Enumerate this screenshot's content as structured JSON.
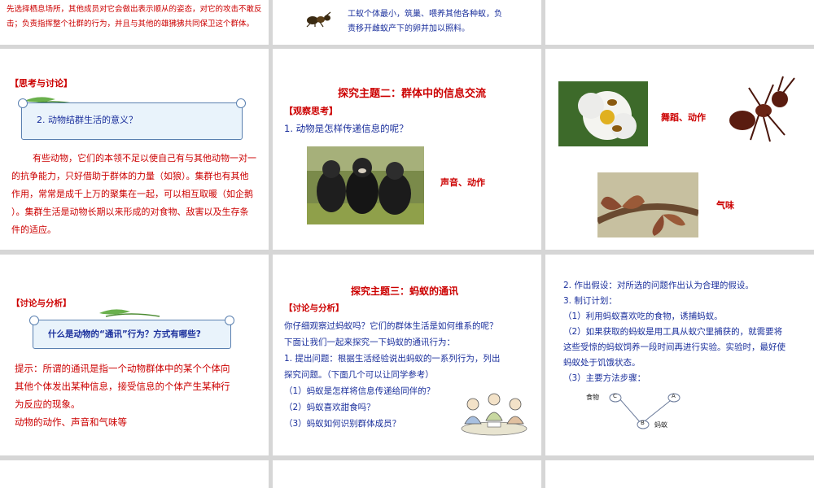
{
  "s1": {
    "line1": "先选择栖息场所，其他成员对它会做出表示顺从的姿态，对它的攻击不敢反",
    "line2": "击；负责指挥整个社群的行为，并且与其他的雄狒狒共同保卫这个群体。"
  },
  "s2": {
    "line1": "工蚁个体最小，筑巢、喂养其他各种蚁，负",
    "line2": "责移开雌蚁产下的卵并加以照料。"
  },
  "s4": {
    "heading": "【思考与讨论】",
    "question": "2. 动物结群生活的意义？",
    "p": [
      "有些动物，它们的本领不足以使自己有与其他动物一对一",
      "的抗争能力，只好借助于群体的力量（如狼）。集群也有其他",
      "作用，常常是成千上万的聚集在一起，可以相互取暖（如企鹅",
      "）。集群生活是动物长期以来形成的对食物、敌害以及生存条",
      "件的适应。"
    ]
  },
  "s5": {
    "title": "探究主题二：群体中的信息交流",
    "heading": "【观察思考】",
    "question": "1. 动物是怎样传递信息的呢？",
    "caption": "声音、动作"
  },
  "s6": {
    "caption1": "舞蹈、动作",
    "caption2": "气味"
  },
  "s7": {
    "heading": "【讨论与分析】",
    "question": "什么是动物的“通讯”行为？方式有哪些?",
    "p": [
      "提示：所谓的通讯是指一个动物群体中的某个个体向",
      "其他个体发出某种信息，接受信息的个体产生某种行",
      "为反应的现象。"
    ],
    "answer": "动物的动作、声音和气味等"
  },
  "s8": {
    "title": "探究主题三：蚂蚁的通讯",
    "heading": "【讨论与分析】",
    "lines": [
      "你仔细观察过蚂蚁吗？它们的群体生活是如何维系的呢？",
      "下面让我们一起来探究一下蚂蚁的通讯行为：",
      "1. 提出问题：根据生活经验说出蚂蚁的一系列行为，列出",
      "探究问题。（下面几个可以让同学参考）",
      "（1）蚂蚁是怎样将信息传递给同伴的？",
      "（2）蚂蚁喜欢甜食吗？",
      "（3）蚂蚁如何识别群体成员？"
    ]
  },
  "s9": {
    "lines": [
      "2. 作出假设：对所选的问题作出认为合理的假设。",
      "3. 制订计划：",
      "（1）利用蚂蚁喜欢吃的食物，诱捕蚂蚁。",
      "（2）如果获取的蚂蚁是用工具从蚁穴里捕获的，就需要将",
      "这些受惊的蚂蚁饲养一段时间再进行实验。实验时，最好使",
      "蚂蚁处于饥饿状态。",
      "（3）主要方法步骤："
    ],
    "diagram": {
      "food_label": "食物",
      "node_c": "C",
      "node_a": "A",
      "node_b": "B",
      "ant_label": "蚂蚁"
    }
  }
}
